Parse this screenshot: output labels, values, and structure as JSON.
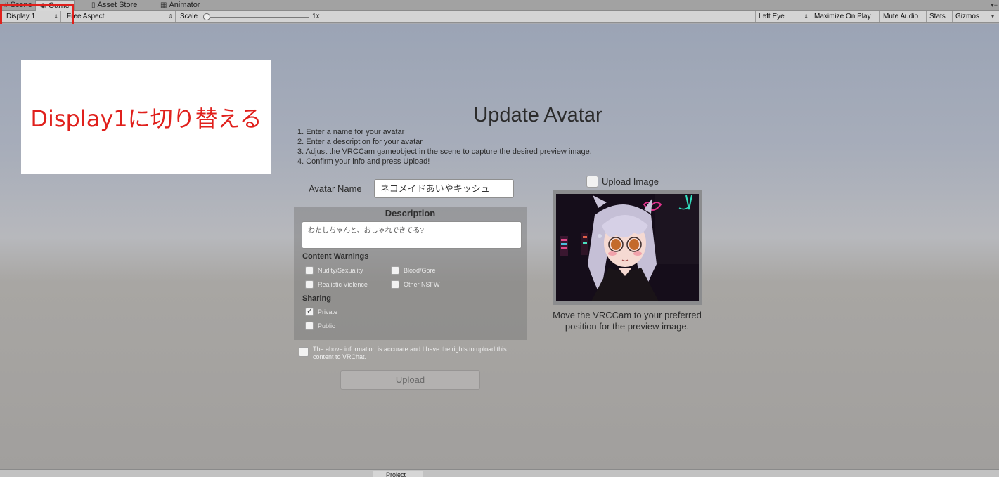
{
  "tabs": [
    {
      "label": "Scene",
      "icon": "scene-icon"
    },
    {
      "label": "Game",
      "icon": "game-icon"
    },
    {
      "label": "Asset Store",
      "icon": "asset-store-icon"
    },
    {
      "label": "Animator",
      "icon": "animator-icon"
    }
  ],
  "toolbar": {
    "display": "Display 1",
    "aspect": "Free Aspect",
    "scale_label": "Scale",
    "scale_value": "1x",
    "eye": "Left Eye",
    "maximize": "Maximize On Play",
    "mute": "Mute Audio",
    "stats": "Stats",
    "gizmos": "Gizmos"
  },
  "annotation": {
    "note": "Display1に切り替える",
    "highlight_color": "#e0201c"
  },
  "panel": {
    "title": "Update Avatar",
    "instructions": [
      "1. Enter a name for your avatar",
      "2. Enter a description for your avatar",
      "3. Adjust the VRCCam gameobject in the scene to capture the desired preview image.",
      "4. Confirm your info and press Upload!"
    ],
    "avatar_name_label": "Avatar Name",
    "avatar_name_value": "ネコメイドあいやキッシュ",
    "description_header": "Description",
    "description_value": "わたしちゃんと、おしゃれできてる?",
    "content_warnings_label": "Content Warnings",
    "content_warnings": [
      {
        "label": "Nudity/Sexuality",
        "checked": false
      },
      {
        "label": "Blood/Gore",
        "checked": false
      },
      {
        "label": "Realistic Violence",
        "checked": false
      },
      {
        "label": "Other NSFW",
        "checked": false
      }
    ],
    "sharing_label": "Sharing",
    "sharing": [
      {
        "label": "Private",
        "checked": true
      },
      {
        "label": "Public",
        "checked": false
      }
    ],
    "agreement": "The above information is accurate and I have the rights to upload this content to VRChat.",
    "upload_button": "Upload",
    "upload_image_label": "Upload Image",
    "preview_caption": "Move the VRCCam to your preferred position for the preview image."
  },
  "bottom": {
    "project_tab": "Project"
  }
}
